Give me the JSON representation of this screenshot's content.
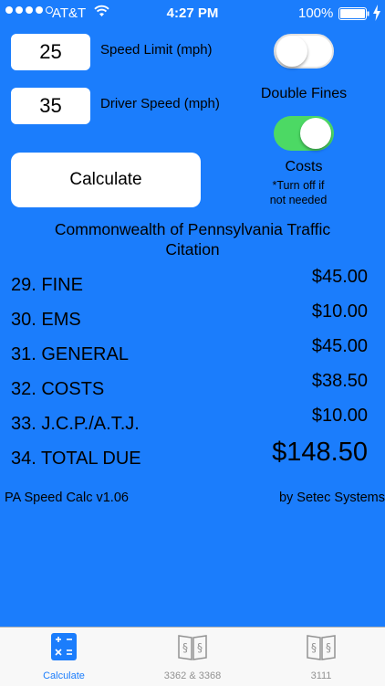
{
  "status_bar": {
    "carrier": "AT&T",
    "time": "4:27 PM",
    "battery_percent": "100%",
    "signal_bars": 4,
    "signal_icon": "signal-dots-icon",
    "wifi_icon": "wifi-icon",
    "battery_icon": "battery-icon",
    "charging_icon": "charging-bolt-icon"
  },
  "inputs": {
    "speed_limit": {
      "value": "25",
      "label": "Speed Limit (mph)"
    },
    "driver_speed": {
      "value": "35",
      "label": "Driver Speed (mph)"
    }
  },
  "toggles": {
    "double_fines": {
      "label": "Double Fines",
      "on": false
    },
    "costs": {
      "label": "Costs",
      "note_line1": "*Turn off if",
      "note_line2": "not needed",
      "on": true
    },
    "on_color": "#4cd964"
  },
  "calculate_button": {
    "label": "Calculate"
  },
  "citation_title": {
    "line1": "Commonwealth of Pennsylvania Traffic",
    "line2": "Citation"
  },
  "fees": [
    {
      "label": "29. FINE",
      "value": "$45.00"
    },
    {
      "label": "30. EMS",
      "value": "$10.00"
    },
    {
      "label": "31. GENERAL",
      "value": "$45.00"
    },
    {
      "label": "32. COSTS",
      "value": "$38.50"
    },
    {
      "label": "33. J.C.P./A.T.J.",
      "value": "$10.00"
    }
  ],
  "total": {
    "label": "34. TOTAL DUE",
    "value": "$148.50"
  },
  "footer": {
    "version": "PA Speed Calc v1.06",
    "credit": "by Setec Systems"
  },
  "tab_bar": {
    "tabs": [
      {
        "label": "Calculate",
        "icon": "calculator-icon",
        "active": true
      },
      {
        "label": "3362 & 3368",
        "icon": "law-book-icon",
        "active": false
      },
      {
        "label": "3111",
        "icon": "law-book-icon",
        "active": false
      }
    ]
  },
  "colors": {
    "background": "#1b7dfc",
    "accent": "#1b7dfc",
    "tab_inactive": "#929292"
  }
}
